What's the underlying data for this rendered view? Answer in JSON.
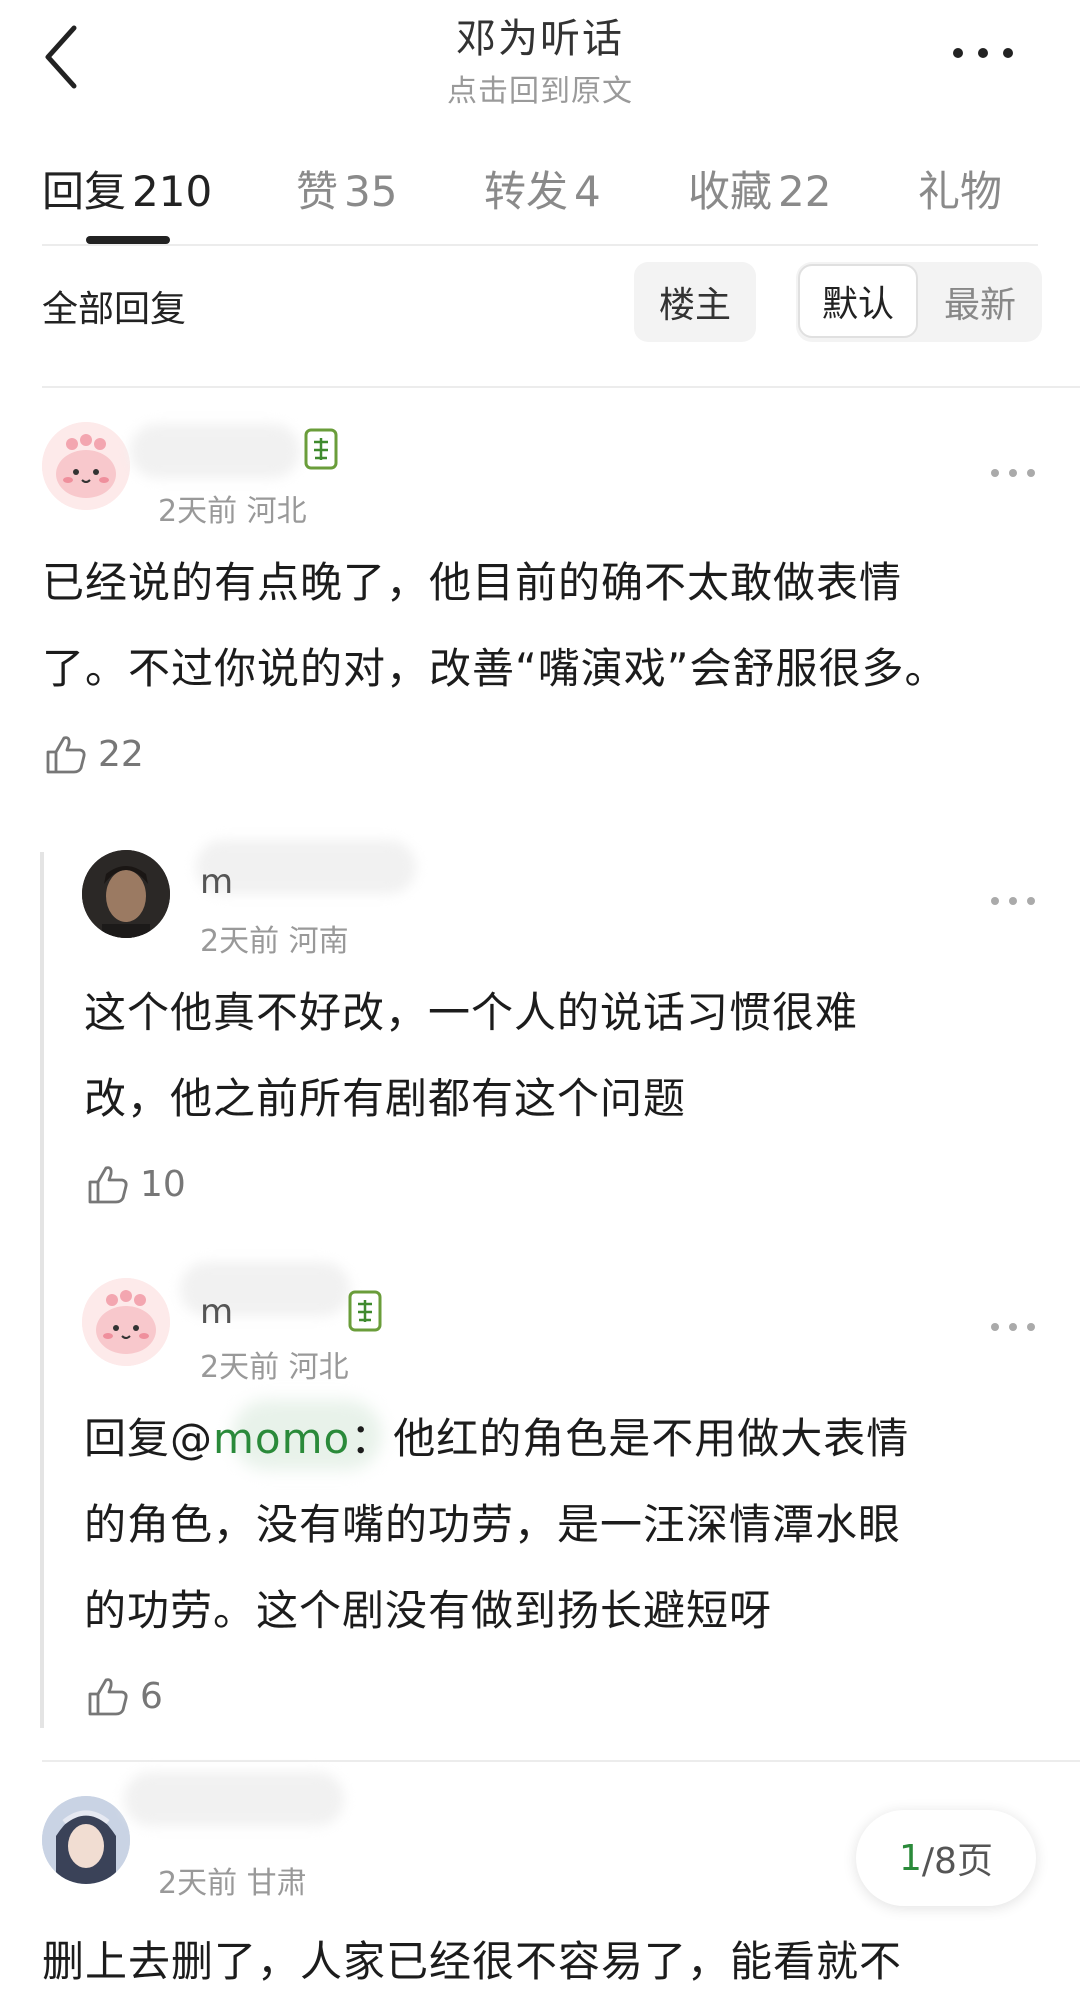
{
  "header": {
    "title": "邓为听话",
    "subtitle": "点击回到原文"
  },
  "tabs": [
    {
      "label": "回复",
      "count": "210"
    },
    {
      "label": "赞",
      "count": "35"
    },
    {
      "label": "转发",
      "count": "4"
    },
    {
      "label": "收藏",
      "count": "22"
    },
    {
      "label": "礼物",
      "count": ""
    }
  ],
  "filter": {
    "all_label": "全部回复",
    "owner_label": "楼主",
    "sort_default": "默认",
    "sort_latest": "最新"
  },
  "comments": [
    {
      "meta": "2天前 河北",
      "text_line1": "已经说的有点晚了，他目前的确不太敢做表情",
      "text_line2": "了。不过你说的对，改善“嘴演戏”会舒服很多。",
      "likes": "22"
    },
    {
      "name_fragment": "m",
      "meta": "2天前 河南",
      "text_line1": "这个他真不好改，一个人的说话习惯很难",
      "text_line2": "改，他之前所有剧都有这个问题",
      "likes": "10"
    },
    {
      "name_fragment": "m",
      "meta": "2天前 河北",
      "reply_prefix": "回复@",
      "mention": "momo",
      "text_line1_rest": "：他红的角色是不用做大表情",
      "text_line2": "的角色，没有嘴的功劳，是一汪深情潭水眼",
      "text_line3": "的功劳。这个剧没有做到扬长避短呀",
      "likes": "6"
    },
    {
      "meta": "2天前 甘肃",
      "text_partial": "删上去删了，人家已经很不容易了，能看就不"
    }
  ],
  "pager": {
    "current": "1",
    "rest": "/8页"
  }
}
